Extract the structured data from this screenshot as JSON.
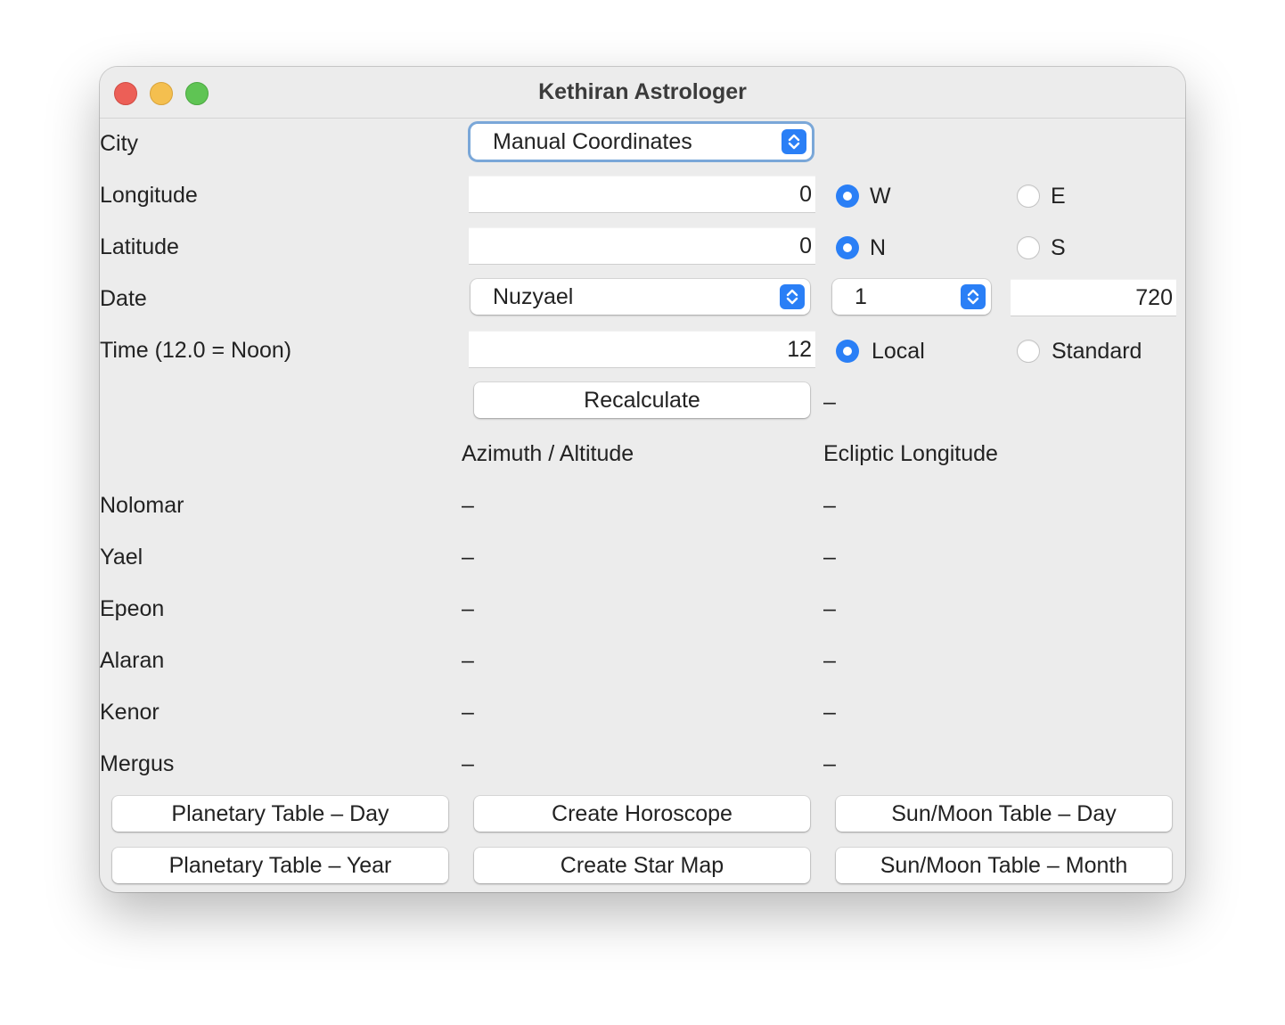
{
  "window": {
    "title": "Kethiran Astrologer"
  },
  "form": {
    "city_label": "City",
    "city_value": "Manual Coordinates",
    "longitude_label": "Longitude",
    "longitude_value": "0",
    "longitude_dirs": [
      "W",
      "E"
    ],
    "longitude_selected": "W",
    "latitude_label": "Latitude",
    "latitude_value": "0",
    "latitude_dirs": [
      "N",
      "S"
    ],
    "latitude_selected": "N",
    "date_label": "Date",
    "date_month": "Nuzyael",
    "date_day": "1",
    "date_year": "720",
    "time_label": "Time (12.0 = Noon)",
    "time_value": "12",
    "time_modes": [
      "Local",
      "Standard"
    ],
    "time_selected": "Local",
    "recalculate_label": "Recalculate",
    "status": "–"
  },
  "results": {
    "col_azalt": "Azimuth / Altitude",
    "col_eclip": "Ecliptic Longitude",
    "rows": [
      {
        "name": "Nolomar",
        "azalt": "–",
        "eclip": "–"
      },
      {
        "name": "Yael",
        "azalt": "–",
        "eclip": "–"
      },
      {
        "name": "Epeon",
        "azalt": "–",
        "eclip": "–"
      },
      {
        "name": "Alaran",
        "azalt": "–",
        "eclip": "–"
      },
      {
        "name": "Kenor",
        "azalt": "–",
        "eclip": "–"
      },
      {
        "name": "Mergus",
        "azalt": "–",
        "eclip": "–"
      }
    ]
  },
  "actions": {
    "planetary_day": "Planetary Table – Day",
    "create_horoscope": "Create Horoscope",
    "sunmoon_day": "Sun/Moon Table – Day",
    "planetary_year": "Planetary Table – Year",
    "create_star_map": "Create Star Map",
    "sunmoon_month": "Sun/Moon Table – Month"
  },
  "colors": {
    "accent": "#2a7ff6",
    "window_bg": "#ececec"
  }
}
